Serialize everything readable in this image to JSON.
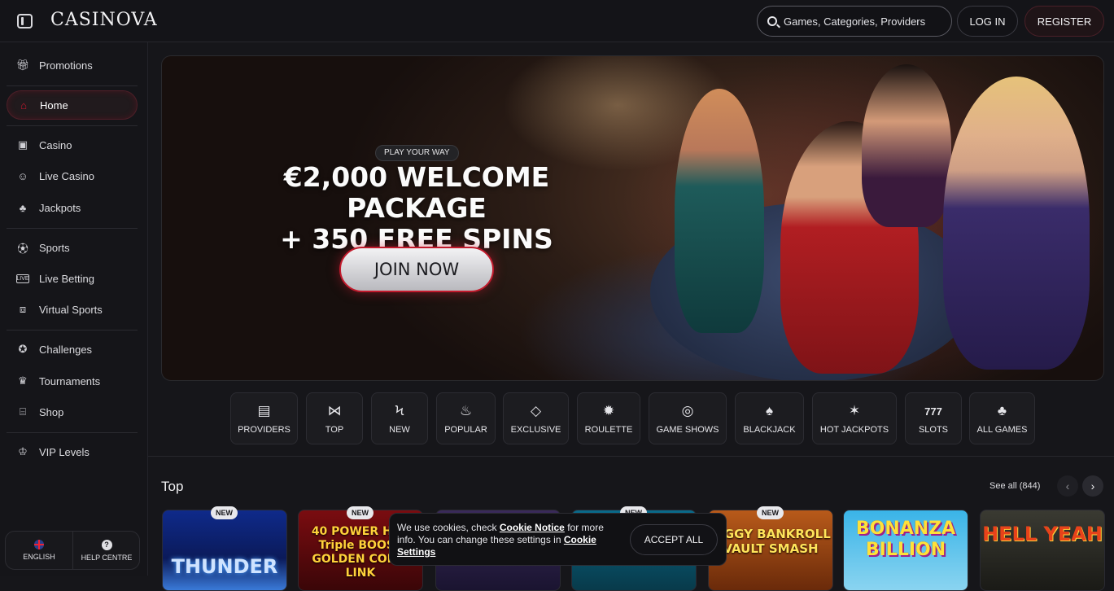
{
  "header": {
    "logo": "CASINOVA",
    "search_placeholder": "Games, Categories, Providers",
    "login_label": "LOG IN",
    "register_label": "REGISTER"
  },
  "sidebar": {
    "items": [
      {
        "label": "Promotions",
        "icon": "gift-icon"
      },
      {
        "label": "Home",
        "icon": "home-icon",
        "active": true
      },
      {
        "label": "Casino",
        "icon": "slot-machine-icon"
      },
      {
        "label": "Live Casino",
        "icon": "dealer-icon"
      },
      {
        "label": "Jackpots",
        "icon": "clover-icon"
      },
      {
        "label": "Sports",
        "icon": "soccer-ball-icon"
      },
      {
        "label": "Live Betting",
        "icon": "live-icon"
      },
      {
        "label": "Virtual Sports",
        "icon": "virtual-screen-icon"
      },
      {
        "label": "Challenges",
        "icon": "medal-icon"
      },
      {
        "label": "Tournaments",
        "icon": "trophy-icon"
      },
      {
        "label": "Shop",
        "icon": "shop-icon"
      },
      {
        "label": "VIP Levels",
        "icon": "crown-icon"
      }
    ],
    "footer": {
      "language_label": "ENGLISH",
      "help_label": "HELP CENTRE"
    }
  },
  "hero": {
    "kicker": "PLAY YOUR WAY",
    "headline_line1": "€2,000 WELCOME PACKAGE",
    "headline_line2": "+ 350 FREE SPINS",
    "cta": "JOIN NOW"
  },
  "categories": [
    {
      "label": "PROVIDERS",
      "icon": "providers-icon"
    },
    {
      "label": "TOP",
      "icon": "bowtie-icon"
    },
    {
      "label": "NEW",
      "icon": "lightning-icon"
    },
    {
      "label": "POPULAR",
      "icon": "flame-icon"
    },
    {
      "label": "EXCLUSIVE",
      "icon": "diamond-icon"
    },
    {
      "label": "ROULETTE",
      "icon": "roulette-icon"
    },
    {
      "label": "GAME SHOWS",
      "icon": "mask-icon"
    },
    {
      "label": "BLACKJACK",
      "icon": "cards-icon"
    },
    {
      "label": "HOT JACKPOTS",
      "icon": "hot-coin-icon"
    },
    {
      "label": "SLOTS",
      "icon": "777-icon"
    },
    {
      "label": "ALL GAMES",
      "icon": "suits-icon"
    }
  ],
  "games_section": {
    "title": "Top",
    "see_all": "See all (844)",
    "tiles": [
      {
        "name": "THUNDER",
        "badge": "NEW"
      },
      {
        "name": "40 POWER HOT Triple BOOST GOLDEN COINS LINK",
        "badge": "NEW"
      },
      {
        "name": "",
        "badge": ""
      },
      {
        "name": "",
        "badge": "NEW"
      },
      {
        "name": "PIGGY BANKROLL VAULT SMASH",
        "badge": "NEW"
      },
      {
        "name": "BONANZA BILLION",
        "badge": ""
      },
      {
        "name": "HELL YEAH",
        "badge": ""
      }
    ]
  },
  "cookie_banner": {
    "text_before": "We use cookies, check ",
    "link1": "Cookie Notice",
    "text_middle": " for more info. You can change these settings in ",
    "link2": "Cookie Settings",
    "accept_label": "ACCEPT ALL"
  },
  "colors": {
    "accent": "#c8182e",
    "background": "#16161a"
  }
}
